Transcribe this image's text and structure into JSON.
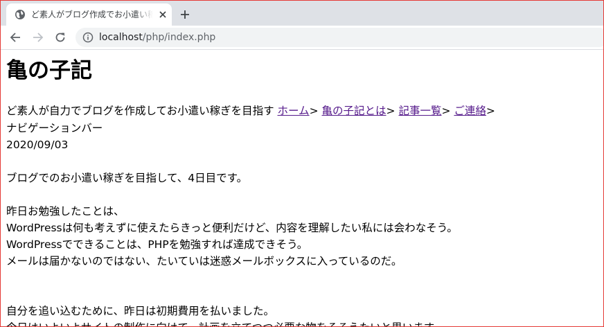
{
  "browser": {
    "tab": {
      "title": "ど素人がブログ作成でお小遣い稼ぎを目指す",
      "close_icon": "close-icon",
      "favicon": "globe-icon"
    },
    "new_tab_icon": "plus-icon",
    "toolbar": {
      "back_icon": "arrow-left-icon",
      "forward_icon": "arrow-right-icon",
      "reload_icon": "reload-icon",
      "info_icon": "info-icon",
      "url_host": "localhost",
      "url_path": "/php/index.php"
    }
  },
  "page": {
    "title": "亀の子記",
    "tagline": "ど素人が自力でブログを作成してお小遣い稼ぎを目指す",
    "nav": [
      {
        "label": "ホーム",
        "sep": ">"
      },
      {
        "label": "亀の子記とは",
        "sep": ">"
      },
      {
        "label": "記事一覧",
        "sep": ">"
      },
      {
        "label": "ご連絡",
        "sep": ">"
      }
    ],
    "nav_caption": "ナビゲーションバー",
    "date": "2020/09/03",
    "body_lines": [
      "ブログでのお小遣い稼ぎを目指して、4日目です。",
      "昨日お勉強したことは、",
      "WordPressは何も考えずに使えたらきっと便利だけど、内容を理解したい私には会わなそう。",
      "WordPressでできることは、PHPを勉強すれば達成できそう。",
      "メールは届かないのではない、たいていは迷惑メールボックスに入っているのだ。",
      "自分を追い込むために、昨日は初期費用を払いました。",
      "今日はいよいよサイトの制作に向けて、計画を立てつつ必要な物をそろえたいと思います。"
    ]
  },
  "colors": {
    "tabstrip": "#dee1e6",
    "omnibox": "#f1f3f4",
    "visited_link": "#551a8b",
    "window_border": "#e53935"
  }
}
